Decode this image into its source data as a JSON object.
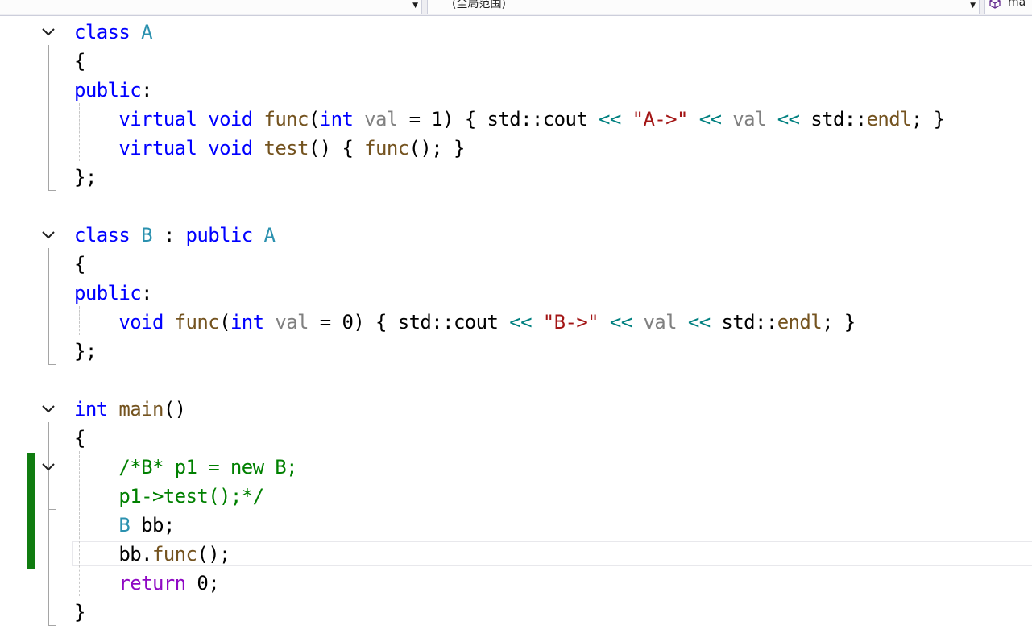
{
  "nav_bar": {
    "scope_label": "(全局范围)",
    "member_label": "ma"
  },
  "editor": {
    "lines": [
      {
        "t": [
          [
            "class",
            "kw"
          ],
          [
            " ",
            ""
          ],
          [
            "A",
            "ty"
          ]
        ]
      },
      {
        "t": [
          [
            "{",
            ""
          ]
        ]
      },
      {
        "t": [
          [
            "public",
            "kw"
          ],
          [
            ":",
            ""
          ]
        ]
      },
      {
        "t": [
          [
            "    ",
            ""
          ],
          [
            "virtual",
            "kw"
          ],
          [
            " ",
            ""
          ],
          [
            "void",
            "kw"
          ],
          [
            " ",
            ""
          ],
          [
            "func",
            "fn"
          ],
          [
            "(",
            ""
          ],
          [
            "int",
            "kw"
          ],
          [
            " ",
            ""
          ],
          [
            "val",
            "pm"
          ],
          [
            " = 1) { std::cout ",
            ""
          ],
          [
            "<<",
            "op"
          ],
          [
            " ",
            ""
          ],
          [
            "\"A->\"",
            "st"
          ],
          [
            " ",
            ""
          ],
          [
            "<<",
            "op"
          ],
          [
            " ",
            ""
          ],
          [
            "val",
            "pm"
          ],
          [
            " ",
            ""
          ],
          [
            "<<",
            "op"
          ],
          [
            " std::",
            ""
          ],
          [
            "endl",
            "fn"
          ],
          [
            "; }",
            ""
          ]
        ]
      },
      {
        "t": [
          [
            "    ",
            ""
          ],
          [
            "virtual",
            "kw"
          ],
          [
            " ",
            ""
          ],
          [
            "void",
            "kw"
          ],
          [
            " ",
            ""
          ],
          [
            "test",
            "fn"
          ],
          [
            "() { ",
            ""
          ],
          [
            "func",
            "fn"
          ],
          [
            "(); }",
            ""
          ]
        ]
      },
      {
        "t": [
          [
            "};",
            ""
          ]
        ]
      },
      {
        "t": []
      },
      {
        "t": [
          [
            "class",
            "kw"
          ],
          [
            " ",
            ""
          ],
          [
            "B",
            "ty"
          ],
          [
            " : ",
            ""
          ],
          [
            "public",
            "kw"
          ],
          [
            " ",
            ""
          ],
          [
            "A",
            "ty"
          ]
        ]
      },
      {
        "t": [
          [
            "{",
            ""
          ]
        ]
      },
      {
        "t": [
          [
            "public",
            "kw"
          ],
          [
            ":",
            ""
          ]
        ]
      },
      {
        "t": [
          [
            "    ",
            ""
          ],
          [
            "void",
            "kw"
          ],
          [
            " ",
            ""
          ],
          [
            "func",
            "fn"
          ],
          [
            "(",
            ""
          ],
          [
            "int",
            "kw"
          ],
          [
            " ",
            ""
          ],
          [
            "val",
            "pm"
          ],
          [
            " = 0) { std::cout ",
            ""
          ],
          [
            "<<",
            "op"
          ],
          [
            " ",
            ""
          ],
          [
            "\"B->\"",
            "st"
          ],
          [
            " ",
            ""
          ],
          [
            "<<",
            "op"
          ],
          [
            " ",
            ""
          ],
          [
            "val",
            "pm"
          ],
          [
            " ",
            ""
          ],
          [
            "<<",
            "op"
          ],
          [
            " std::",
            ""
          ],
          [
            "endl",
            "fn"
          ],
          [
            "; }",
            ""
          ]
        ]
      },
      {
        "t": [
          [
            "};",
            ""
          ]
        ]
      },
      {
        "t": []
      },
      {
        "t": [
          [
            "int",
            "kw"
          ],
          [
            " ",
            ""
          ],
          [
            "main",
            "fn"
          ],
          [
            "()",
            ""
          ]
        ]
      },
      {
        "t": [
          [
            "{",
            ""
          ]
        ]
      },
      {
        "t": [
          [
            "    ",
            ""
          ],
          [
            "/*B* p1 = new B;",
            "cm"
          ]
        ]
      },
      {
        "t": [
          [
            "    ",
            ""
          ],
          [
            "p1->test();*/",
            "cm"
          ]
        ]
      },
      {
        "t": [
          [
            "    ",
            ""
          ],
          [
            "B",
            "ty"
          ],
          [
            " bb;",
            ""
          ]
        ]
      },
      {
        "t": [
          [
            "    bb.",
            ""
          ],
          [
            "func",
            "fn"
          ],
          [
            "();",
            ""
          ]
        ]
      },
      {
        "t": [
          [
            "    ",
            ""
          ],
          [
            "return",
            "ct"
          ],
          [
            " 0;",
            ""
          ]
        ]
      },
      {
        "t": [
          [
            "}",
            ""
          ]
        ]
      }
    ]
  },
  "colors": {
    "keyword": "#0000ff",
    "type": "#2b91af",
    "function": "#74531f",
    "parameter": "#808080",
    "string": "#a31515",
    "operator": "#008080",
    "comment": "#008000",
    "control": "#8f08c4",
    "change_bar": "#107c10"
  },
  "icons": {
    "fold": "chevron-down-icon",
    "member": "cube-icon"
  }
}
